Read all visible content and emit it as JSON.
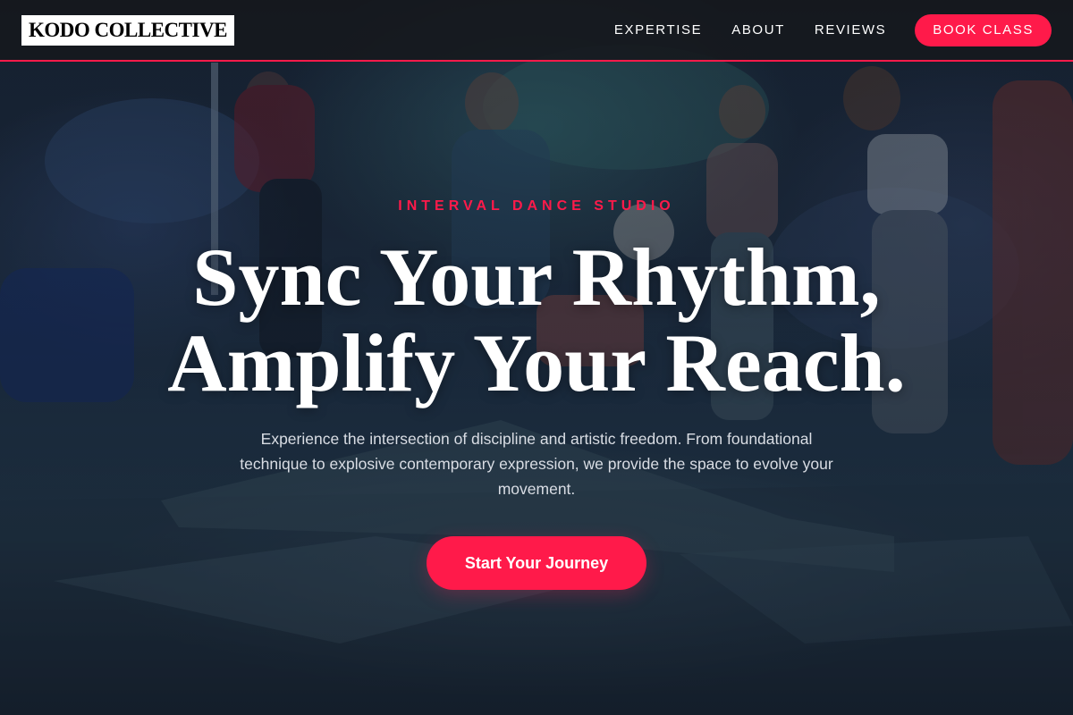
{
  "header": {
    "logo_text": "KODO COLLECTIVE",
    "nav": [
      {
        "label": "EXPERTISE"
      },
      {
        "label": "ABOUT"
      },
      {
        "label": "REVIEWS"
      }
    ],
    "book_button_label": "BOOK CLASS"
  },
  "hero": {
    "eyebrow": "INTERVAL DANCE STUDIO",
    "headline_line1": "Sync Your Rhythm,",
    "headline_line2": "Amplify Your Reach.",
    "subtext": "Experience the intersection of discipline and artistic freedom. From foundational technique to explosive contemporary expression, we provide the space to evolve your movement.",
    "cta_label": "Start Your Journey",
    "background_image": "dance-studio-photo"
  },
  "colors": {
    "accent": "#ff1a4a",
    "header_bg": "#16181c",
    "text_primary": "#ffffff",
    "text_secondary": "#d9dde4"
  }
}
